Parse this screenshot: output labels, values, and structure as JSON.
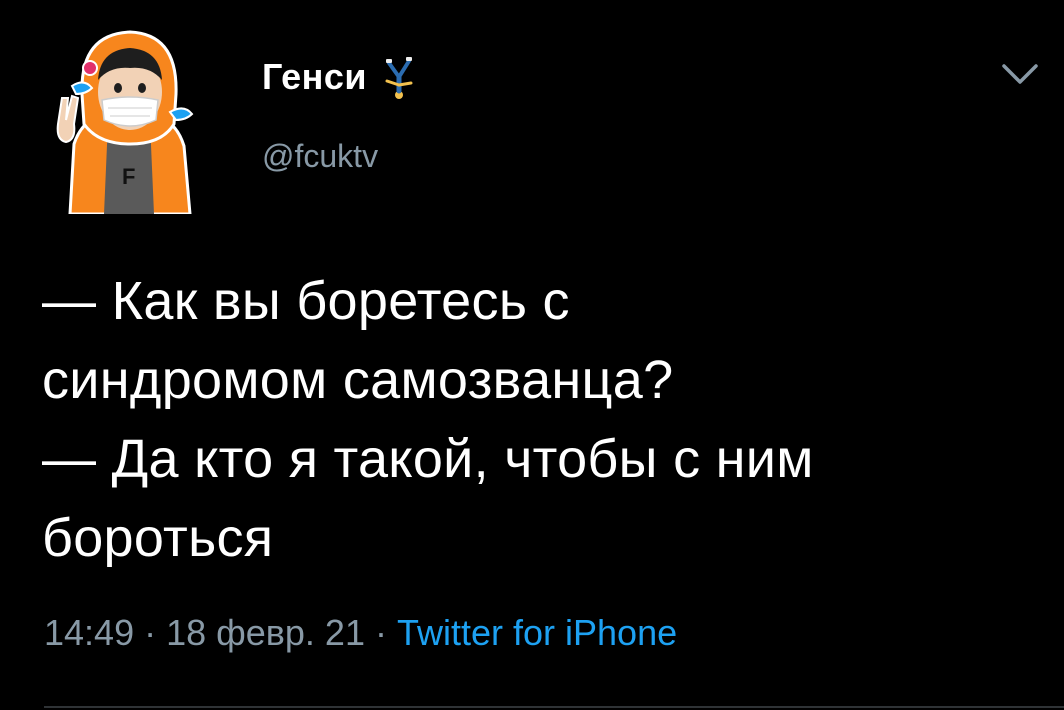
{
  "user": {
    "display_name": "Генси",
    "handle": "@fcuktv",
    "avatar": "cartoon-avatar-orange-hoodie-mask",
    "name_emoji": "person-cartwheeling-emoji"
  },
  "tweet": {
    "lines": [
      "— Как вы боретесь с",
      "синдромом самозванца?",
      "— Да кто я такой, чтобы с ним",
      "бороться"
    ]
  },
  "meta": {
    "time": "14:49",
    "separator1": " · ",
    "date": "18 февр. 21",
    "separator2": " · ",
    "source": "Twitter for iPhone"
  },
  "icons": {
    "menu": "chevron-down-icon"
  },
  "colors": {
    "background": "#000000",
    "text": "#ffffff",
    "muted": "#8899a6",
    "link": "#1da1f2",
    "hoodie": "#f7861d"
  }
}
